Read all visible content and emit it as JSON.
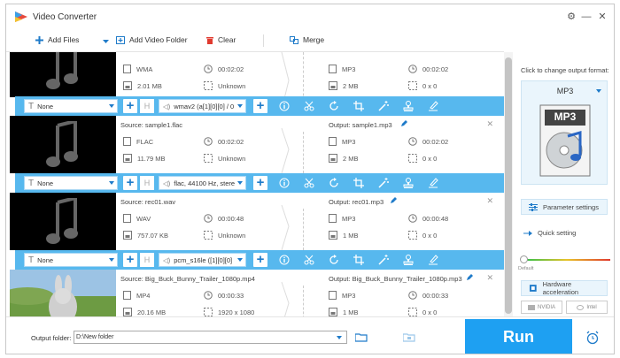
{
  "app": {
    "title": "Video Converter"
  },
  "window_controls": {
    "settings": "⚙",
    "minimize": "—",
    "close": "✕"
  },
  "toolbar": {
    "add_files": "Add Files",
    "add_video_folder": "Add Video Folder",
    "clear": "Clear",
    "merge": "Merge"
  },
  "items": [
    {
      "source": "",
      "output": "",
      "src_format": "WMA",
      "src_duration": "00:02:02",
      "src_size": "2.01 MB",
      "src_res": "Unknown",
      "out_format": "MP3",
      "out_duration": "00:02:02",
      "out_size": "2 MB",
      "out_res": "0 x 0",
      "subtitle": "None",
      "audio": "wmav2 (a[1][0][0] / 0"
    },
    {
      "source": "Source: sample1.flac",
      "output": "Output: sample1.mp3",
      "src_format": "FLAC",
      "src_duration": "00:02:02",
      "src_size": "11.79 MB",
      "src_res": "Unknown",
      "out_format": "MP3",
      "out_duration": "00:02:02",
      "out_size": "2 MB",
      "out_res": "0 x 0",
      "subtitle": "None",
      "audio": "flac, 44100 Hz, stere"
    },
    {
      "source": "Source: rec01.wav",
      "output": "Output: rec01.mp3",
      "src_format": "WAV",
      "src_duration": "00:00:48",
      "src_size": "757.07 KB",
      "src_res": "Unknown",
      "out_format": "MP3",
      "out_duration": "00:00:48",
      "out_size": "1 MB",
      "out_res": "0 x 0",
      "subtitle": "None",
      "audio": "pcm_s16le ([1][0][0]"
    },
    {
      "source": "Source: Big_Buck_Bunny_Trailer_1080p.mp4",
      "output": "Output: Big_Buck_Bunny_Trailer_1080p.mp3",
      "src_format": "MP4",
      "src_duration": "00:00:33",
      "src_size": "20.16 MB",
      "src_res": "1920 x 1080",
      "out_format": "MP3",
      "out_duration": "00:00:33",
      "out_size": "1 MB",
      "out_res": "0 x 0"
    }
  ],
  "right_panel": {
    "title": "Click to change output format:",
    "format": "MP3",
    "format_icon_label": "MP3",
    "parameter_settings": "Parameter settings",
    "quick_setting": "Quick setting",
    "default_label": "Default",
    "hardware_acceleration": "Hardware acceleration",
    "nvidia": "NVIDIA",
    "intel": "Intel"
  },
  "footer": {
    "output_folder_label": "Output folder:",
    "output_folder_value": "D:\\New folder",
    "run": "Run"
  },
  "colors": {
    "accent": "#1ea0f2",
    "bar": "#57b8ee",
    "panel": "#eaf5fc"
  }
}
